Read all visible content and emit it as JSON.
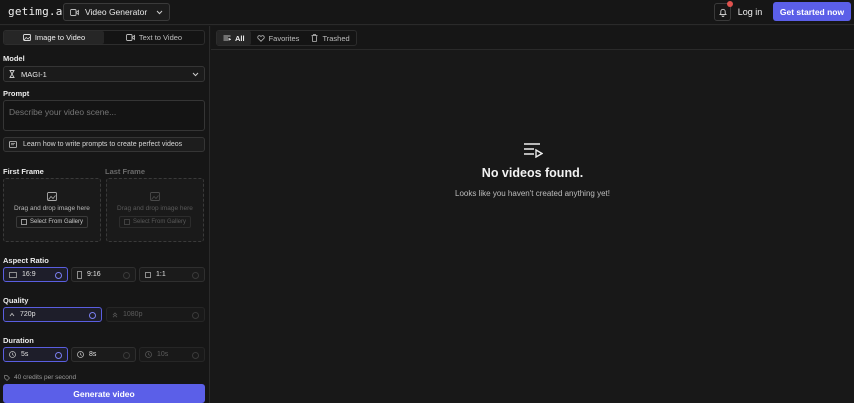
{
  "header": {
    "logo": "getimg.ai",
    "app_selector": "Video Generator",
    "login_label": "Log in",
    "cta_label": "Get started now",
    "accent": "#5b5fe8"
  },
  "sidebar": {
    "tabs": [
      {
        "label": "Image to Video",
        "icon": "image-icon",
        "active": true
      },
      {
        "label": "Text to Video",
        "icon": "video-icon",
        "active": false
      }
    ],
    "model": {
      "section": "Model",
      "value": "MAGI-1"
    },
    "prompt": {
      "section": "Prompt",
      "placeholder": "Describe your video scene..."
    },
    "learn_label": "Learn how to write prompts to create perfect videos",
    "frames": {
      "first": {
        "section": "First Frame",
        "drop": "Drag and drop image here",
        "gallery": "Select From Gallery"
      },
      "last": {
        "section": "Last Frame",
        "drop": "Drag and drop image here",
        "gallery": "Select From Gallery"
      }
    },
    "aspect": {
      "section": "Aspect Ratio",
      "options": [
        "16:9",
        "9:16",
        "1:1"
      ],
      "selected": "16:9"
    },
    "quality": {
      "section": "Quality",
      "options": [
        "720p",
        "1080p"
      ],
      "selected": "720p"
    },
    "duration": {
      "section": "Duration",
      "options": [
        "5s",
        "8s",
        "10s"
      ],
      "selected": "5s"
    },
    "credits": "40 credits per second",
    "generate_label": "Generate video"
  },
  "main": {
    "filters": [
      {
        "label": "All",
        "icon": "list-icon",
        "active": true
      },
      {
        "label": "Favorites",
        "icon": "heart-icon",
        "active": false
      },
      {
        "label": "Trashed",
        "icon": "trash-icon",
        "active": false
      }
    ],
    "empty_title": "No videos found.",
    "empty_text": "Looks like you haven't created anything yet!"
  }
}
